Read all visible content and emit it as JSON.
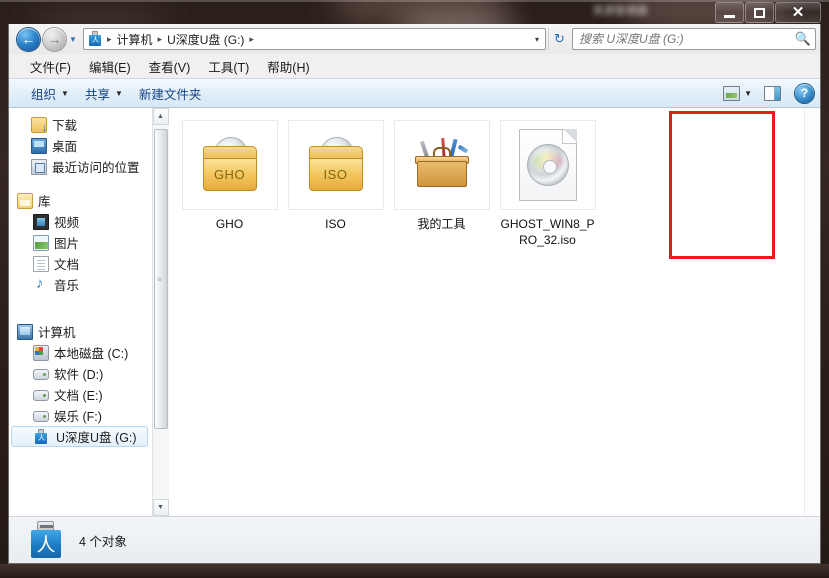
{
  "window": {
    "title": "资源管理器",
    "caption_buttons": [
      {
        "name": "minimize",
        "glyph": "—"
      },
      {
        "name": "maximize",
        "glyph": "□"
      },
      {
        "name": "close",
        "glyph": "✕"
      }
    ]
  },
  "navigation": {
    "back_glyph": "←",
    "forward_glyph": "→",
    "history_dropdown_glyph": "▼",
    "refresh_glyph": "↻"
  },
  "address": {
    "drive_icon": "usb-drive-icon",
    "crumbs": [
      "计算机",
      "U深度U盘 (G:)"
    ],
    "separator": "▸",
    "dropdown_glyph": "▾"
  },
  "search": {
    "placeholder": "搜索 U深度U盘 (G:)",
    "value": "",
    "icon": "search-icon",
    "icon_glyph": "🔍"
  },
  "menubar": {
    "items": [
      {
        "label": "文件(F)",
        "name": "menu-file"
      },
      {
        "label": "编辑(E)",
        "name": "menu-edit"
      },
      {
        "label": "查看(V)",
        "name": "menu-view"
      },
      {
        "label": "工具(T)",
        "name": "menu-tools"
      },
      {
        "label": "帮助(H)",
        "name": "menu-help"
      }
    ]
  },
  "toolbar": {
    "organize_label": "组织",
    "share_label": "共享",
    "new_folder_label": "新建文件夹",
    "caret_glyph": "▼",
    "view_icon": "view-options-icon",
    "preview_pane_icon": "preview-pane-icon",
    "help_icon": "help-icon",
    "help_glyph": "?"
  },
  "navpane": {
    "favorites": [
      {
        "label": "下载",
        "icon": "download-icon",
        "name": "sidebar-item-downloads"
      },
      {
        "label": "桌面",
        "icon": "desktop-icon",
        "name": "sidebar-item-desktop"
      },
      {
        "label": "最近访问的位置",
        "icon": "recent-places-icon",
        "name": "sidebar-item-recent-places"
      }
    ],
    "library_group": {
      "label": "库",
      "icon": "library-icon",
      "name": "sidebar-group-libraries"
    },
    "libraries": [
      {
        "label": "视频",
        "icon": "video-icon",
        "name": "sidebar-item-videos"
      },
      {
        "label": "图片",
        "icon": "picture-icon",
        "name": "sidebar-item-pictures"
      },
      {
        "label": "文档",
        "icon": "document-icon",
        "name": "sidebar-item-documents"
      },
      {
        "label": "音乐",
        "icon": "music-icon",
        "name": "sidebar-item-music"
      }
    ],
    "computer_group": {
      "label": "计算机",
      "icon": "computer-icon",
      "name": "sidebar-group-computer"
    },
    "drives": [
      {
        "label": "本地磁盘 (C:)",
        "icon": "system-drive-icon",
        "name": "sidebar-item-drive-c",
        "selected": false
      },
      {
        "label": "软件 (D:)",
        "icon": "drive-icon",
        "name": "sidebar-item-drive-d",
        "selected": false
      },
      {
        "label": "文档 (E:)",
        "icon": "drive-icon",
        "name": "sidebar-item-drive-e",
        "selected": false
      },
      {
        "label": "娱乐 (F:)",
        "icon": "drive-icon",
        "name": "sidebar-item-drive-f",
        "selected": false
      },
      {
        "label": "U深度U盘 (G:)",
        "icon": "usb-drive-icon",
        "name": "sidebar-item-drive-g",
        "selected": true
      }
    ],
    "scrollbar": {
      "up_glyph": "▲",
      "down_glyph": "▼",
      "grip_glyph": "≡"
    }
  },
  "files": [
    {
      "name": "GHO",
      "label": "GHO",
      "icon": "folder-disc-icon",
      "folder_text": "GHO",
      "selected": false
    },
    {
      "name": "ISO",
      "label": "ISO",
      "icon": "folder-disc-icon",
      "folder_text": "ISO",
      "selected": false
    },
    {
      "name": "我的工具",
      "label": "我的工具",
      "icon": "toolbox-icon",
      "folder_text": "",
      "selected": false
    },
    {
      "name": "GHOST_WIN8_PRO_32.iso",
      "label": "GHOST_WIN8_PRO_32.iso",
      "icon": "iso-file-icon",
      "folder_text": "",
      "selected": true
    }
  ],
  "annotation": {
    "target": "GHOST_WIN8_PRO_32.iso",
    "color": "#e71d1d"
  },
  "statusbar": {
    "icon": "usb-drive-icon",
    "usb_glyph": "⚡",
    "text": "4 个对象"
  },
  "colors": {
    "accent_blue": "#15428b",
    "annotation_red": "#e71d1d",
    "toolbar_bg": "#e2eef8",
    "selection_blue": "#b6d8f2"
  }
}
